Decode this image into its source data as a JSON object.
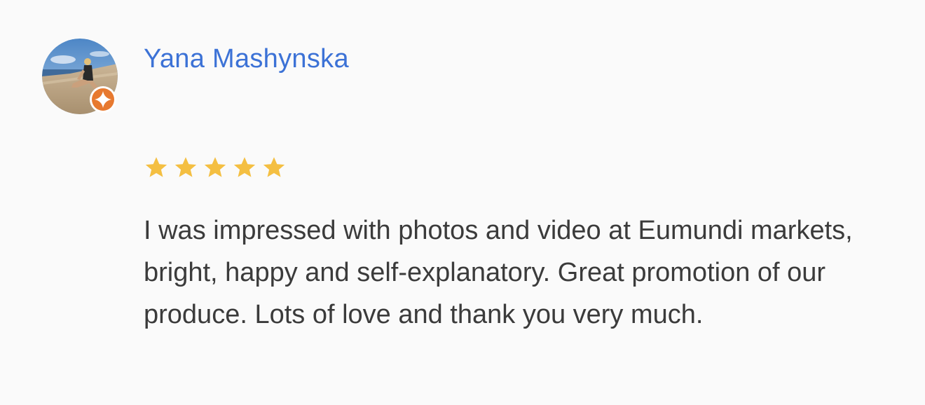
{
  "review": {
    "reviewer_name": "Yana Mashynska",
    "avatar_icon": "profile-photo",
    "badge_icon": "local-guide-badge-icon",
    "badge_color": "#e7792f",
    "rating": 5,
    "rating_max": 5,
    "star_color": "#f4bf42",
    "text": "I was impressed with photos and video at Eumundi markets, bright, happy and self-explanatory. Great promotion of our produce. Lots of love and thank you very much."
  },
  "colors": {
    "background": "#fafafa",
    "name": "#3c72d6",
    "text": "#3b3b3b"
  }
}
